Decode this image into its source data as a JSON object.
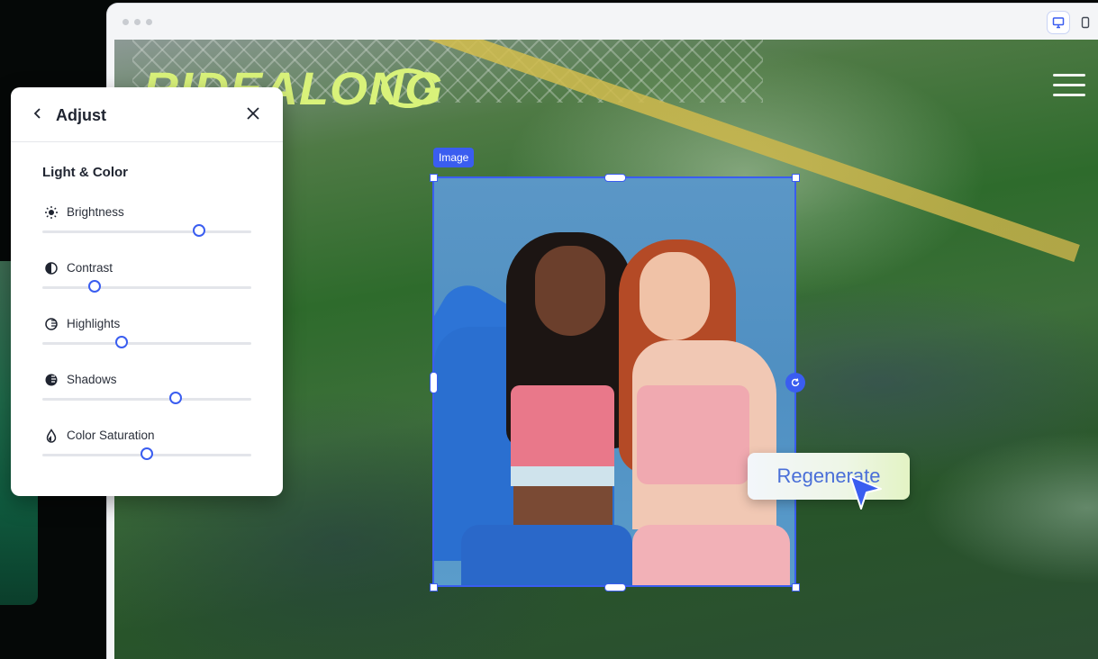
{
  "brand": {
    "logo_text": "RIDEALONG"
  },
  "panel": {
    "title": "Adjust",
    "section": "Light & Color",
    "controls": [
      {
        "label": "Brightness",
        "icon": "brightness-icon",
        "value": 0.75
      },
      {
        "label": "Contrast",
        "icon": "contrast-icon",
        "value": 0.25
      },
      {
        "label": "Highlights",
        "icon": "highlights-icon",
        "value": 0.38
      },
      {
        "label": "Shadows",
        "icon": "shadows-icon",
        "value": 0.64
      },
      {
        "label": "Color Saturation",
        "icon": "saturation-icon",
        "value": 0.5
      }
    ]
  },
  "canvas": {
    "image_tag": "Image",
    "regenerate_label": "Regenerate"
  },
  "colors": {
    "accent": "#3a5df0",
    "brand": "#d9f27a"
  }
}
